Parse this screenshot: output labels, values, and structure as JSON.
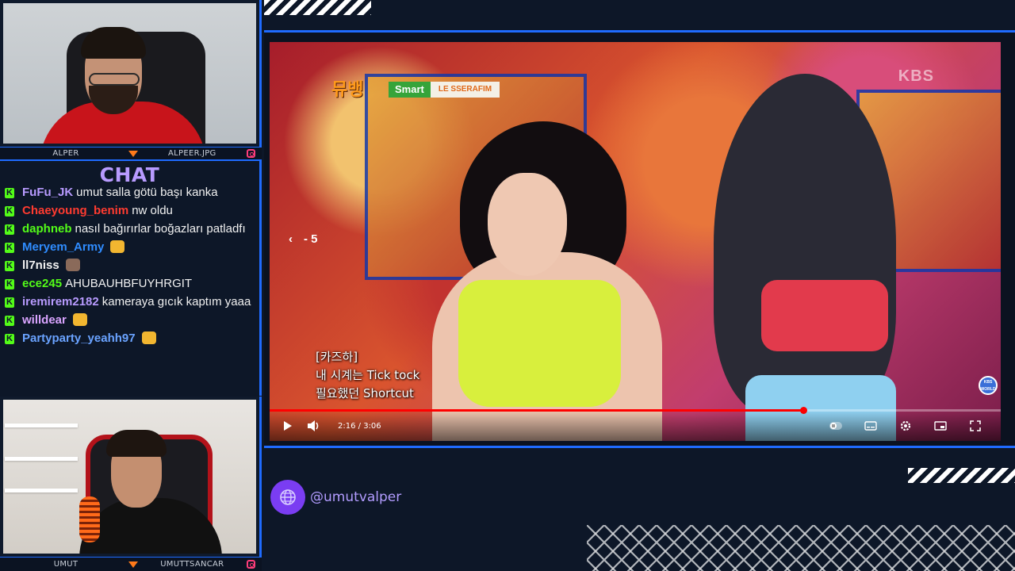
{
  "streamer_top": {
    "name": "ALPER",
    "social": "ALPEER.JPG"
  },
  "chat": {
    "title": "CHAT",
    "messages": [
      {
        "user": "FuFu_JK",
        "color": "#b89bff",
        "text": "umut salla götü başı kanka",
        "emote": ""
      },
      {
        "user": "Chaeyoung_benim",
        "color": "#ff3b30",
        "text": "nw oldu",
        "emote": ""
      },
      {
        "user": "daphneb",
        "color": "#53fc18",
        "text": "nasıl bağırırlar boğazları patladfı",
        "emote": ""
      },
      {
        "user": "Meryem_Army",
        "color": "#2f8cff",
        "text": "",
        "emote": "cat-emote"
      },
      {
        "user": "ll7niss",
        "color": "#f1f1f1",
        "text": "",
        "emote": "face-emote"
      },
      {
        "user": "ece245",
        "color": "#53fc18",
        "text": "AHUBAUHBFUYHRGIT",
        "emote": ""
      },
      {
        "user": "iremirem2182",
        "color": "#b89bff",
        "text": "kameraya gıcık kaptım yaaa",
        "emote": ""
      },
      {
        "user": "willdear",
        "color": "#d9a4ff",
        "text": "",
        "emote": "cat-emote"
      },
      {
        "user": "Partyparty_yeahh97",
        "color": "#6aa3ff",
        "text": "",
        "emote": "cat-emote"
      }
    ]
  },
  "streamer_bottom": {
    "name": "UMUT",
    "social": "UMUTTSANCAR"
  },
  "video": {
    "song_title": "Smart",
    "artist": "LE SSERAFIM",
    "broadcaster": "KBS",
    "world_badge": "KBS WORLD",
    "seek_label": "5",
    "subtitles": [
      "[카즈하]",
      "내 시계는 Tick tock",
      "필요했던 Shortcut"
    ],
    "time_current": "2:16",
    "time_total": "3:06",
    "progress": 0.73
  },
  "branding": {
    "handle": "@umutvalper"
  },
  "colors": {
    "accent": "#1f6bff",
    "kick_green": "#53fc18",
    "purple": "#7a3df2"
  }
}
